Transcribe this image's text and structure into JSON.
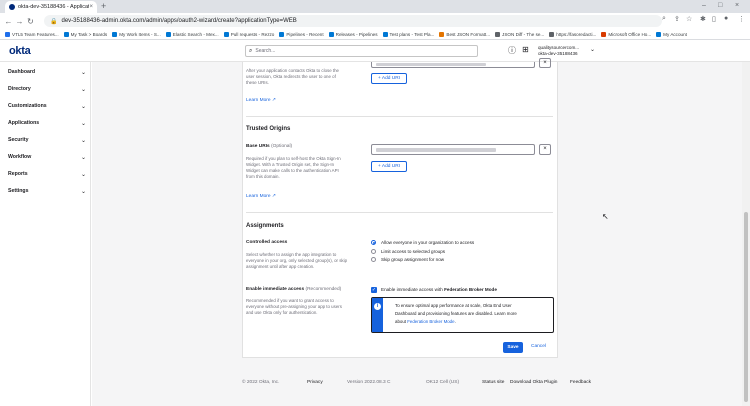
{
  "browser": {
    "tab_title": "okta-dev-35188436 - Applicatio",
    "tab_close": "×",
    "new_tab": "+",
    "url": "dev-35188436-admin.okta.com/admin/apps/oauth2-wizard/create?applicationType=WEB",
    "window_controls": [
      "–",
      "□",
      "×"
    ],
    "bookmarks": [
      {
        "label": "VTL5 Team Features...",
        "color": "#1f6feb"
      },
      {
        "label": "My Task > Boards",
        "color": "#0078d4"
      },
      {
        "label": "My Work Items - S...",
        "color": "#0078d4"
      },
      {
        "label": "Elastic Search - Mex...",
        "color": "#0078d4"
      },
      {
        "label": "Pull requests - Rezzo",
        "color": "#0078d4"
      },
      {
        "label": "Pipelines - Recent",
        "color": "#0078d4"
      },
      {
        "label": "Releases - Pipelines",
        "color": "#0078d4"
      },
      {
        "label": "Test plans - Test Pla...",
        "color": "#0078d4"
      },
      {
        "label": "Best JSON Formatt...",
        "color": "#e37400"
      },
      {
        "label": "JSON Diff - The se...",
        "color": "#5f6368"
      },
      {
        "label": "https://fasoredacti...",
        "color": "#5f6368"
      },
      {
        "label": "Microsoft Office Ho...",
        "color": "#d83b01"
      },
      {
        "label": "My Account",
        "color": "#0078d4"
      }
    ]
  },
  "header": {
    "logo": "okta",
    "search_placeholder": "Search...",
    "org_name": "qualitysourcercom...",
    "org_id": "okta-dev-35188436"
  },
  "sidebar": {
    "items": [
      {
        "label": "Dashboard"
      },
      {
        "label": "Directory"
      },
      {
        "label": "Customizations"
      },
      {
        "label": "Applications"
      },
      {
        "label": "Security"
      },
      {
        "label": "Workflow"
      },
      {
        "label": "Reports"
      },
      {
        "label": "Settings"
      }
    ]
  },
  "form": {
    "signout_help": [
      "After your application contacts Okta to close the",
      "user session, Okta redirects the user to one of",
      "these URIs."
    ],
    "learn_more": "Learn More",
    "add_uri": "+ Add URI",
    "trusted_origins": {
      "title": "Trusted Origins",
      "base_uris_label": "Base URIs",
      "optional": "(Optional)",
      "help": [
        "Required if you plan to self-host the Okta Sign-In",
        "Widget. With a Trusted Origin set, the Sign-In",
        "Widget can make calls to the authentication API",
        "from this domain."
      ],
      "learn_more": "Learn More",
      "add_uri": "+ Add URI"
    },
    "assignments": {
      "title": "Assignments",
      "controlled_access_label": "Controlled access",
      "controlled_access_help": [
        "Select whether to assign the app integration to",
        "everyone in your org, only selected group(s), or skip",
        "assignment until after app creation."
      ],
      "options": [
        {
          "label": "Allow everyone in your organization to access",
          "selected": true
        },
        {
          "label": "Limit access to selected groups",
          "selected": false
        },
        {
          "label": "Skip group assignment for now",
          "selected": false
        }
      ],
      "immediate_label": "Enable immediate access",
      "immediate_recommended": "(Recommended)",
      "immediate_help": [
        "Recommended if you want to grant access to",
        "everyone without pre-assigning your app to users",
        "and use Okta only for authentication."
      ],
      "checkbox_label_pre": "Enable immediate access with ",
      "checkbox_label_bold": "Federation Broker Mode",
      "info_line1": "To ensure optimal app performance at scale, Okta End User",
      "info_line2": "Dashboard and provisioning features are disabled. Learn more",
      "info_line3_pre": "about ",
      "info_line3_link": "Federation Broker Mode",
      "info_line3_post": "."
    },
    "save": "Save",
    "cancel": "Cancel"
  },
  "footer": {
    "copyright": "© 2022 Okta, Inc.",
    "privacy": "Privacy",
    "version": "Version 2022.08.3 C",
    "cell": "OK12 Cell (US)",
    "status": "Status site",
    "plugin": "Download Okta Plugin",
    "feedback": "Feedback"
  }
}
